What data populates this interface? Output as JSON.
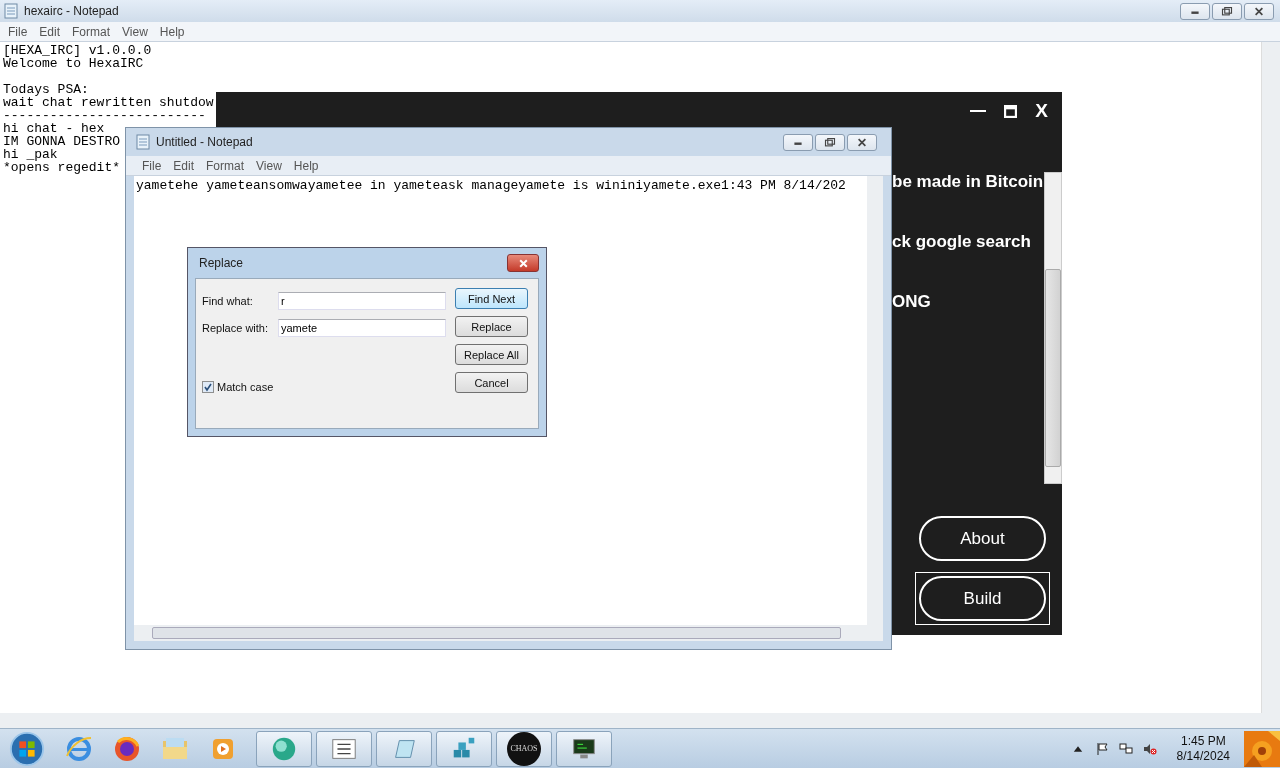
{
  "back_window": {
    "title": "hexairc - Notepad",
    "menu": [
      "File",
      "Edit",
      "Format",
      "View",
      "Help"
    ],
    "blocks": [
      [
        "[HEXA_IRC] v1.0.0.0",
        "Welcome to HexaIRC"
      ],
      [
        "Todays PSA:",
        "wait chat rewritten shutdow",
        "--------------------------",
        "hi chat - hex",
        "IM GONNA DESTRO",
        "hi _pak",
        "*opens regedit*"
      ]
    ]
  },
  "builder_window": {
    "close": "X",
    "lines": [
      "be made in Bitcoin",
      "ck google search",
      "ONG"
    ],
    "buttons": [
      {
        "label": "About",
        "focused": false
      },
      {
        "label": "Build",
        "focused": true
      }
    ]
  },
  "notepad": {
    "title": "Untitled - Notepad",
    "menu": [
      "File",
      "Edit",
      "Format",
      "View",
      "Help"
    ],
    "text": "yametehe yameteansomwayametee in yameteask manageyamete is wininiyamete.exe1:43 PM 8/14/202"
  },
  "replace_dialog": {
    "title": "Replace",
    "fields": [
      {
        "label": "Find what:",
        "value": "r"
      },
      {
        "label": "Replace with:",
        "value": "yamete"
      }
    ],
    "buttons": [
      {
        "label": "Find Next",
        "default": true
      },
      {
        "label": "Replace",
        "default": false
      },
      {
        "label": "Replace All",
        "default": false
      },
      {
        "label": "Cancel",
        "default": false
      }
    ],
    "match_case": {
      "label": "Match case",
      "checked": true
    }
  },
  "taskbar": {
    "chaos_label": "CHAOS",
    "clock": {
      "time": "1:45 PM",
      "date": "8/14/2024"
    }
  }
}
